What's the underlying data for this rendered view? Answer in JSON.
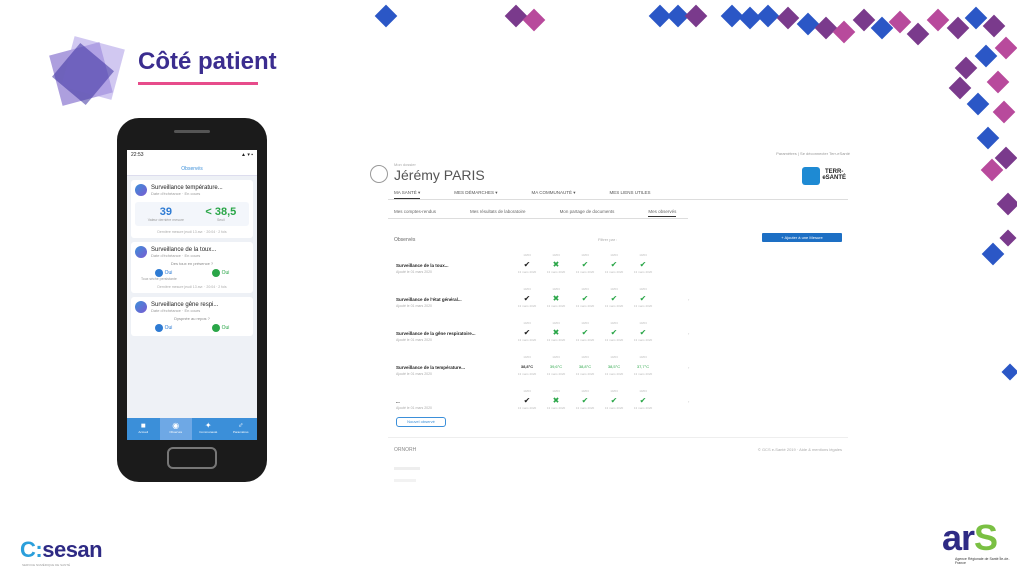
{
  "slide": {
    "title": "Côté patient",
    "colors": {
      "title": "#3b2d8f",
      "accent_blue": "#3b8fd9",
      "accent_green": "#2aa648",
      "diamond_purple": "#7a3a8c",
      "diamond_blue": "#2b57c6",
      "diamond_pink": "#b84a9c"
    }
  },
  "phone": {
    "status_time": "22:53",
    "status_sub": "◂ Messenger",
    "status_right": "▲ ▾ ▪",
    "header": "Observés",
    "cards": [
      {
        "title": "Surveillance température...",
        "sub": "Date d'échéance · En cours",
        "v1": "39",
        "v1_cap": "Valeur dernière mesure",
        "v2": "< 38,5",
        "v2_cap": "Seuil",
        "foot": "Dernière mesure jeudi 13 avr. · 20:04 · 2 fois"
      },
      {
        "title": "Surveillance de la toux...",
        "sub": "Date d'échéance · En cours",
        "mid": "Des toux en présence ?",
        "yes1": "Oui",
        "yes1_cap": "Toux sèche persistante",
        "yes2": "Oui",
        "foot": "Dernière mesure jeudi 13 avr. · 20:04 · 2 fois"
      },
      {
        "title": "Surveillance gêne respi...",
        "sub": "Date d'échéance · En cours",
        "mid": "Dyspnée au repos ?",
        "yes1": "Oui",
        "yes2": "Oui"
      }
    ],
    "tabs": [
      {
        "icon": "■",
        "label": "Accueil"
      },
      {
        "icon": "◉",
        "label": "Observés"
      },
      {
        "icon": "✦",
        "label": "Communauté"
      },
      {
        "icon": "♂",
        "label": "Paramètres"
      }
    ]
  },
  "web": {
    "topinfo": "Paramètres  |  Se déconnecter  Terr-eSanté",
    "patient_small": "Mon dossier",
    "patient_name": "Jérémy PARIS",
    "logo": "TERR-\neSANTÉ",
    "menu": [
      "MA SANTÉ ▾",
      "MES DÉMARCHES ▾",
      "MA COMMUNAUTÉ ▾",
      "MES LIENS UTILES"
    ],
    "subtabs": [
      "Mes comptes-rendus",
      "Mes résultats de laboratoire",
      "Mon partage de documents",
      "Mes observés"
    ],
    "section_title": "Observés",
    "filter_label": "Filtrer par :",
    "add_button": "+ Ajouter à une Mesure",
    "rows": [
      {
        "name": "Surveillance de la toux...",
        "sub": "Ajouté le 01 mars 2020",
        "marks": [
          "✔",
          "✖",
          "✔",
          "✔",
          "✔"
        ],
        "extra": ""
      },
      {
        "name": "Surveillance de l'état général...",
        "sub": "Ajouté le 01 mars 2020",
        "marks": [
          "✔",
          "✖",
          "✔",
          "✔",
          "✔"
        ],
        "extra": "›"
      },
      {
        "name": "Surveillance de la gêne respiratoire...",
        "sub": "Ajouté le 01 mars 2020",
        "marks": [
          "✔",
          "✖",
          "✔",
          "✔",
          "✔"
        ],
        "extra": "›"
      },
      {
        "name": "Surveillance de la température...",
        "sub": "Ajouté le 01 mars 2020",
        "marks": [
          "38,8°C",
          "39,6°C",
          "38,8°C",
          "38,5°C",
          "37,7°C"
        ],
        "extra": "›"
      },
      {
        "name": "...",
        "sub": "Ajouté le 01 mars 2020",
        "marks": [
          "✔",
          "✖",
          "✔",
          "✔",
          "✔"
        ],
        "extra": "›"
      }
    ],
    "cell_top": "10/03",
    "cell_date": "13 mars 2020",
    "new_button": "Nouvel observé",
    "footer_logo": "ORNORH",
    "footer_right": "© GCS e-Santé 2019 · Aide & mentions légales"
  },
  "logos": {
    "sesan_c": "C:",
    "sesan": "sesan",
    "sesan_sub": "SERVICE NUMÉRIQUE DE SANTÉ",
    "ars_main": "ar",
    "ars_s": "S",
    "ars_sub": "Agence Régionale de Santé Île-de-France"
  }
}
